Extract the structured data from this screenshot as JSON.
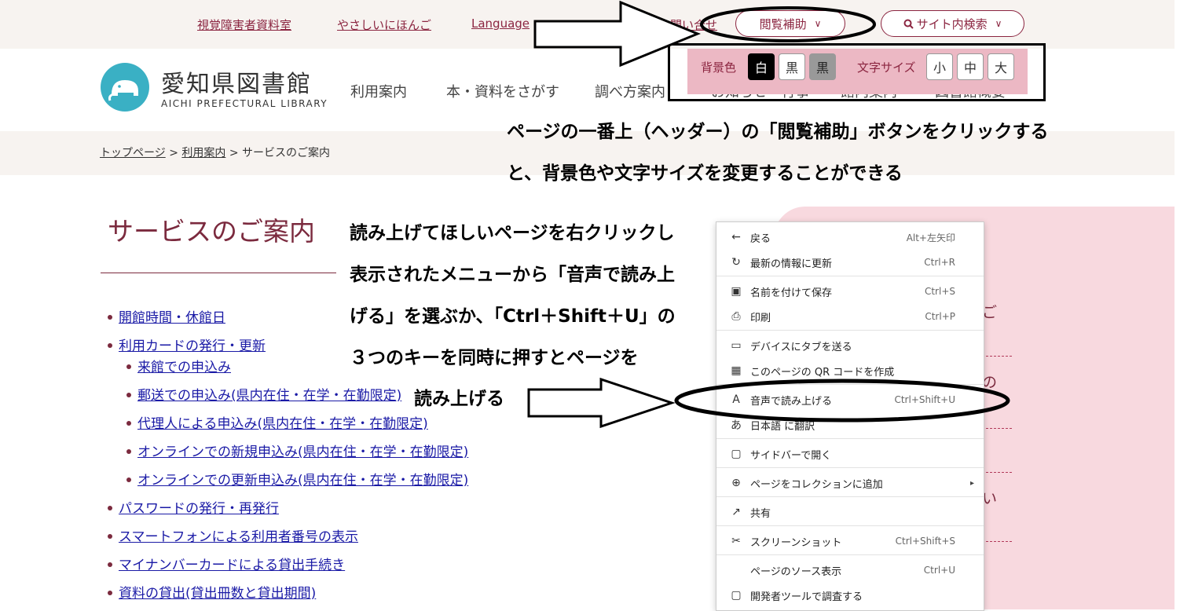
{
  "top_links": [
    "視覚障害者資料室",
    "やさしいにほんご",
    "Language",
    "お問い合せ"
  ],
  "buttons": {
    "reading_aid": "閲覧補助",
    "site_search": "サイト内検索"
  },
  "accessibility": {
    "bg_label": "背景色",
    "bg_options": [
      "白",
      "黒",
      "黒"
    ],
    "size_label": "文字サイズ",
    "size_options": [
      "小",
      "中",
      "大"
    ]
  },
  "site": {
    "name": "愛知県図書館",
    "name_en": "AICHI PREFECTURAL LIBRARY"
  },
  "nav": [
    "利用案内",
    "本・資料をさがす",
    "調べ方案内",
    "お知らせ・行事",
    "館内案内",
    "図書館概要"
  ],
  "breadcrumb": {
    "home": "トップページ",
    "sep": ">",
    "section": "利用案内",
    "current": "サービスのご案内"
  },
  "page_title": "サービスのご案内",
  "service_list": [
    {
      "text": "開館時間・休館日",
      "level": 0
    },
    {
      "text": "利用カードの発行・更新",
      "level": 0
    },
    {
      "text": "来館での申込み",
      "level": 1
    },
    {
      "text": "郵送での申込み(県内在住・在学・在勤限定)",
      "level": 1
    },
    {
      "text": "代理人による申込み(県内在住・在学・在勤限定)",
      "level": 1
    },
    {
      "text": "オンラインでの新規申込み(県内在住・在学・在勤限定)",
      "level": 1
    },
    {
      "text": "オンラインでの更新申込み(県内在住・在学・在勤限定)",
      "level": 1
    },
    {
      "text": "パスワードの発行・再発行",
      "level": 0
    },
    {
      "text": "スマートフォンによる利用者番号の表示",
      "level": 0
    },
    {
      "text": "マイナンバーカードによる貸出手続き",
      "level": 0
    },
    {
      "text": "資料の貸出(貸出冊数と貸出期間)",
      "level": 0
    }
  ],
  "side_panel_fragments": [
    "ご",
    "の",
    "い"
  ],
  "context_menu": [
    {
      "icon": "back-arrow-icon",
      "glyph": "←",
      "label": "戻る",
      "shortcut": "Alt+左矢印"
    },
    {
      "icon": "refresh-icon",
      "glyph": "↻",
      "label": "最新の情報に更新",
      "shortcut": "Ctrl+R"
    },
    {
      "icon": "save-icon",
      "glyph": "▣",
      "label": "名前を付けて保存",
      "shortcut": "Ctrl+S"
    },
    {
      "icon": "print-icon",
      "glyph": "⎙",
      "label": "印刷",
      "shortcut": "Ctrl+P"
    },
    {
      "icon": "send-tab-icon",
      "glyph": "▭",
      "label": "デバイスにタブを送る",
      "shortcut": ""
    },
    {
      "icon": "qr-code-icon",
      "glyph": "▦",
      "label": "このページの QR コードを作成",
      "shortcut": ""
    },
    {
      "icon": "read-aloud-icon",
      "glyph": "A",
      "label": "音声で読み上げる",
      "shortcut": "Ctrl+Shift+U"
    },
    {
      "icon": "translate-icon",
      "glyph": "あ",
      "label": "日本語 に翻訳",
      "shortcut": ""
    },
    {
      "icon": "sidebar-icon",
      "glyph": "▢",
      "label": "サイドバーで開く",
      "shortcut": ""
    },
    {
      "icon": "collection-icon",
      "glyph": "⊕",
      "label": "ページをコレクションに追加",
      "shortcut": "▸"
    },
    {
      "icon": "share-icon",
      "glyph": "↗",
      "label": "共有",
      "shortcut": ""
    },
    {
      "icon": "screenshot-icon",
      "glyph": "✂",
      "label": "スクリーンショット",
      "shortcut": "Ctrl+Shift+S"
    },
    {
      "icon": "",
      "glyph": "",
      "label": "ページのソース表示",
      "shortcut": "Ctrl+U"
    },
    {
      "icon": "devtools-icon",
      "glyph": "▢",
      "label": "開発者ツールで調査する",
      "shortcut": ""
    }
  ],
  "annotations": {
    "header_note_1": "ページの一番上（ヘッダー）の「閲覧補助」ボタンをクリックする",
    "header_note_2": "と、背景色や文字サイズを変更することができる",
    "read_note_1": "読み上げてほしいページを右クリックし",
    "read_note_2": "表示されたメニューから「音声で読み上",
    "read_note_3": "げる」を選ぶか、「Ctrl＋Shift＋U」の",
    "read_note_4": "３つのキーを同時に押すとページを",
    "read_note_5": "読み上げる"
  },
  "colors": {
    "accent": "#8b2540",
    "link": "#1a1aa6",
    "pink": "#f8d9df",
    "logo": "#3ab0c4"
  }
}
